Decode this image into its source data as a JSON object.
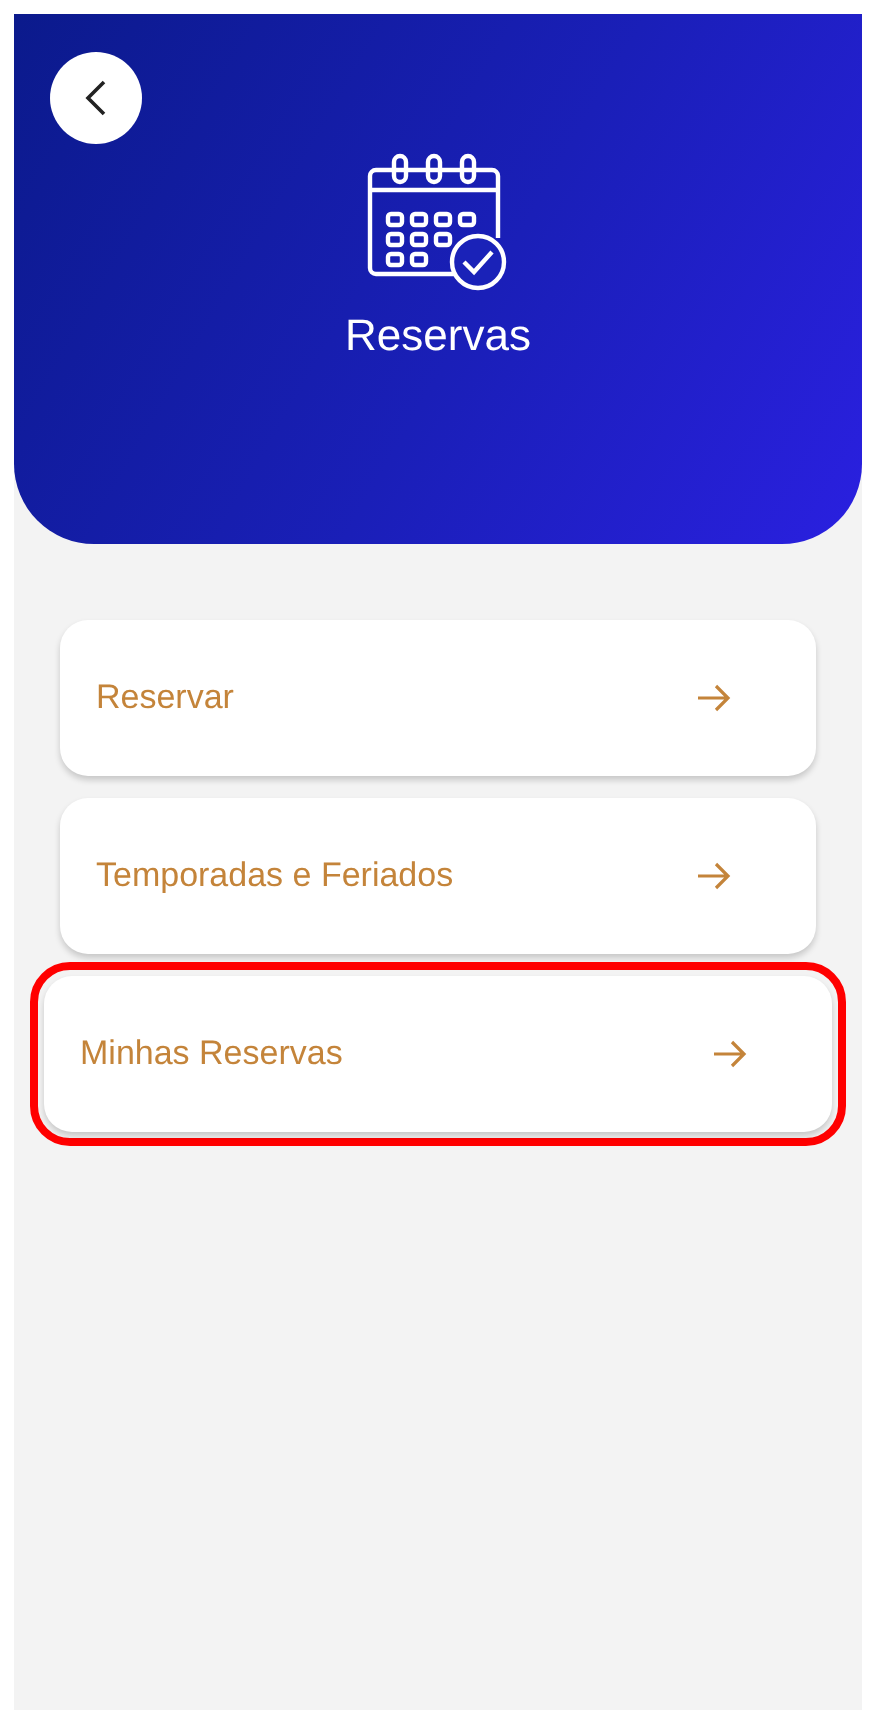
{
  "header": {
    "title": "Reservas"
  },
  "menu": [
    {
      "label": "Reservar",
      "highlighted": false
    },
    {
      "label": "Temporadas e Feriados",
      "highlighted": false
    },
    {
      "label": "Minhas Reservas",
      "highlighted": true
    }
  ]
}
